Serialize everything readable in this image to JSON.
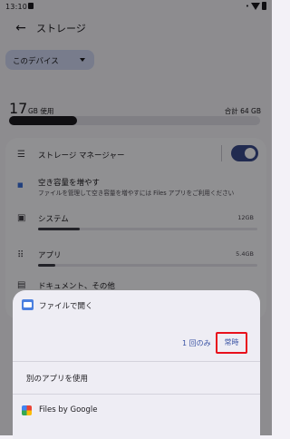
{
  "status_bar": {
    "time": "13:10"
  },
  "app_bar": {
    "title": "ストレージ"
  },
  "device_chip": {
    "label": "このデバイス"
  },
  "usage": {
    "used_value": "17",
    "used_unit": "GB 使用",
    "total": "合計 64 GB",
    "used_fraction": 0.27
  },
  "storage_manager": {
    "title": "ストレージ マネージャー",
    "enabled": true
  },
  "free_up": {
    "title": "空き容量を増やす",
    "subtitle": "ファイルを管理して空き容量を増やすには Files アプリをご利用ください"
  },
  "categories": [
    {
      "label": "システム",
      "value": "12GB",
      "fraction": 0.19
    },
    {
      "label": "アプリ",
      "value": "5.4GB",
      "fraction": 0.08
    },
    {
      "label": "ドキュメント、その他"
    }
  ],
  "sheet": {
    "title": "ファイルで開く",
    "once_label": "1 回のみ",
    "always_label": "常時",
    "other_app_label": "別のアプリを使用",
    "files_app_label": "Files by Google"
  },
  "colors": {
    "accent": "#3a53a4",
    "highlight_box": "#e8101c",
    "chip": "#cfd6f2"
  }
}
